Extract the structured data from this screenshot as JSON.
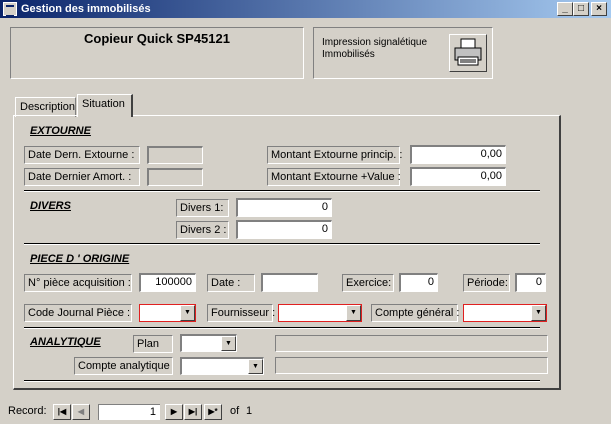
{
  "window": {
    "title": "Gestion des immobilisés",
    "min": "_",
    "max": "□",
    "close": "×"
  },
  "header": {
    "asset_name": "Copieur Quick SP45121",
    "print_line1": "Impression signalétique",
    "print_line2": "Immobilisés"
  },
  "tabs": [
    {
      "label": "Description"
    },
    {
      "label": "Situation"
    }
  ],
  "extourne": {
    "title": "EXTOURNE",
    "date_dern_label": "Date Dern. Extourne :",
    "date_amort_label": "Date Dernier Amort. :",
    "date_dern_value": "",
    "date_amort_value": "",
    "princip_label": "Montant Extourne princip. :",
    "princip_value": "0,00",
    "value_label": "Montant Extourne +Value :",
    "value_value": "0,00"
  },
  "divers": {
    "title": "DIVERS",
    "d1_label": "Divers 1:",
    "d1_value": "0",
    "d2_label": "Divers 2 :",
    "d2_value": "0"
  },
  "piece": {
    "title": "PIECE D ' ORIGINE",
    "num_label": "N° pièce acquisition :",
    "num_value": "100000",
    "date_label": "Date :",
    "date_value": "",
    "exercice_label": "Exercice:",
    "exercice_value": "0",
    "periode_label": "Période:",
    "periode_value": "0",
    "journal_label": "Code Journal Pièce :",
    "journal_value": "",
    "fournisseur_label": "Fournisseur :",
    "fournisseur_value": "",
    "compte_label": "Compte général :",
    "compte_value": ""
  },
  "analytique": {
    "title": "ANALYTIQUE",
    "plan_label": "Plan",
    "plan_value": "",
    "compte_label": "Compte analytique",
    "compte_value": ""
  },
  "record": {
    "label": "Record:",
    "current": "1",
    "of_label": "of",
    "total": "1"
  }
}
